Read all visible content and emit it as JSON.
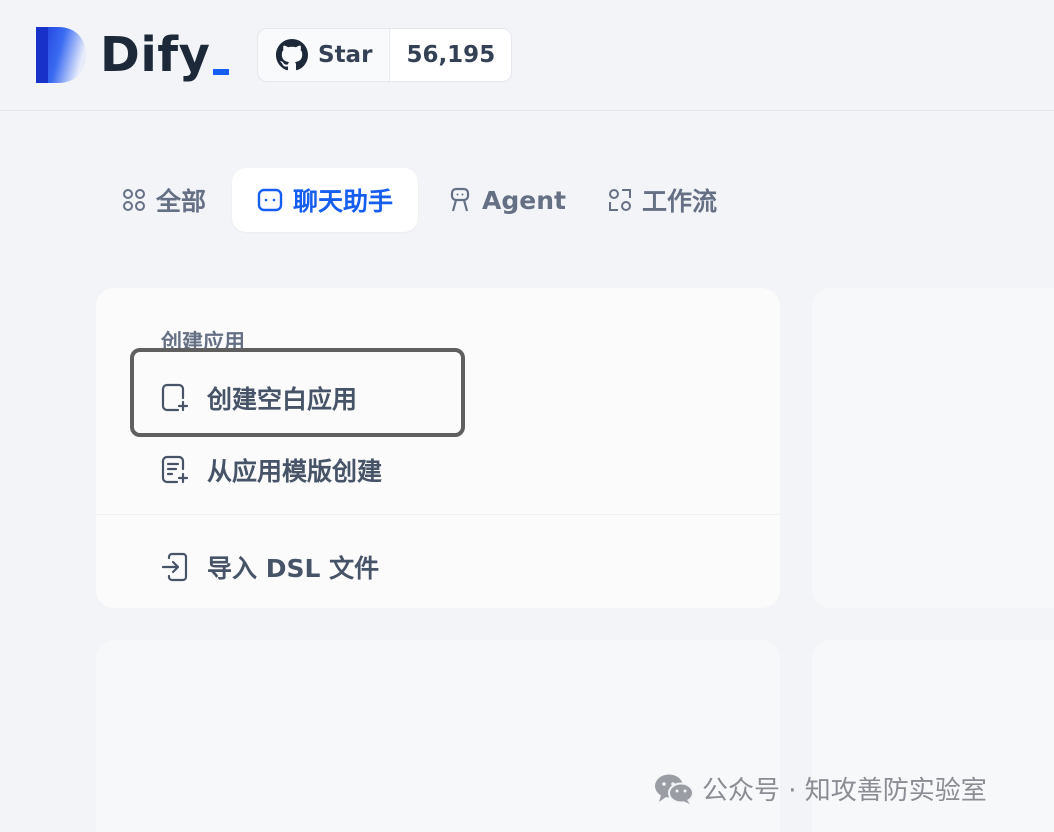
{
  "header": {
    "logo_text": "Dify",
    "github_star_label": "Star",
    "github_star_count": "56,195"
  },
  "tabs": [
    {
      "label": "全部",
      "icon": "grid-icon",
      "active": false
    },
    {
      "label": "聊天助手",
      "icon": "chat-bubble-icon",
      "active": true
    },
    {
      "label": "Agent",
      "icon": "robot-icon",
      "active": false
    },
    {
      "label": "工作流",
      "icon": "workflow-icon",
      "active": false
    }
  ],
  "create_menu": {
    "section_title": "创建应用",
    "items": [
      {
        "label": "创建空白应用",
        "icon": "file-plus-icon"
      },
      {
        "label": "从应用模版创建",
        "icon": "file-template-icon"
      },
      {
        "label": "导入 DSL 文件",
        "icon": "file-import-icon"
      }
    ]
  },
  "watermark": {
    "text": "公众号 · 知攻善防实验室",
    "icon": "wechat-icon"
  },
  "colors": {
    "accent": "#155eef",
    "background": "#f2f4f7",
    "highlight_border": "#5f5f5f"
  }
}
